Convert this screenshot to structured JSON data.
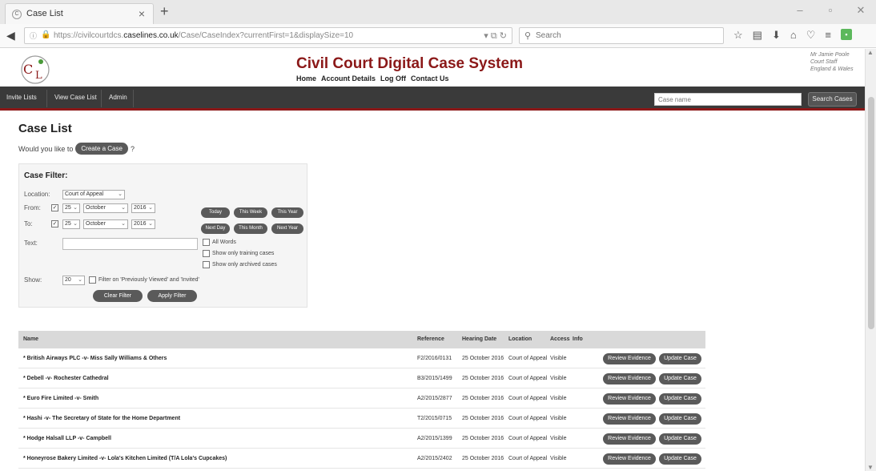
{
  "browser": {
    "tab_title": "Case List",
    "tab_close": "×",
    "new_tab": "+",
    "url_prefix": "https://civilcourtdcs.",
    "url_domain": "caselines.co.uk",
    "url_path": "/Case/CaseIndex?currentFirst=1&displaySize=10",
    "search_placeholder": "Search",
    "window_controls": [
      "–",
      "▫",
      "✕"
    ]
  },
  "header": {
    "logo_text": "C L",
    "title": "Civil Court Digital Case System",
    "links": [
      "Home",
      "Account Details",
      "Log Off",
      "Contact Us"
    ],
    "user_lines": [
      "Mr Jamie Poole",
      "Court Staff",
      "England & Wales"
    ]
  },
  "nav": {
    "items": [
      "Invite Lists",
      "View Case List",
      "Admin"
    ],
    "search_placeholder": "Case name",
    "search_button": "Search Cases"
  },
  "page": {
    "title": "Case List",
    "create_prefix": "Would you like to",
    "create_button": "Create a Case",
    "create_suffix": "?"
  },
  "filter": {
    "title": "Case Filter:",
    "location_label": "Location:",
    "location_value": "Court of Appeal",
    "from_label": "From:",
    "from_day": "25",
    "from_month": "October",
    "from_year": "2016",
    "to_label": "To:",
    "to_day": "25",
    "to_month": "October",
    "to_year": "2016",
    "quick_row1": [
      "Today",
      "This Week",
      "This Year"
    ],
    "quick_row2": [
      "Next Day",
      "This Month",
      "Next Year"
    ],
    "text_label": "Text:",
    "all_words": "All Words",
    "show_training": "Show only training cases",
    "show_archived": "Show only archived cases",
    "show_label": "Show:",
    "show_value": "20",
    "filter_viewed": "Filter on 'Previously Viewed' and 'Invited'",
    "clear_button": "Clear Filter",
    "apply_button": "Apply Filter"
  },
  "table": {
    "headers": [
      "Name",
      "Reference",
      "Hearing Date",
      "Location",
      "Access",
      "Info"
    ],
    "review_label": "Review Evidence",
    "update_label": "Update Case",
    "rows": [
      {
        "name": "* British Airways PLC -v- Miss Sally Williams & Others",
        "reference": "F2/2016/0131",
        "date": "25 October 2016",
        "location": "Court of Appeal",
        "access": "Visible"
      },
      {
        "name": "* Debell -v- Rochester Cathedral",
        "reference": "B3/2015/1499",
        "date": "25 October 2016",
        "location": "Court of Appeal",
        "access": "Visible"
      },
      {
        "name": "* Euro Fire Limited -v- Smith",
        "reference": "A2/2015/2877",
        "date": "25 October 2016",
        "location": "Court of Appeal",
        "access": "Visible"
      },
      {
        "name": "* Hashi -v- The Secretary of State for the Home Department",
        "reference": "T2/2015/0715",
        "date": "25 October 2016",
        "location": "Court of Appeal",
        "access": "Visible"
      },
      {
        "name": "* Hodge Halsall LLP -v- Campbell",
        "reference": "A2/2015/1399",
        "date": "25 October 2016",
        "location": "Court of Appeal",
        "access": "Visible"
      },
      {
        "name": "* Honeyrose Bakery Limited -v- Lola's Kitchen Limited (T/A Lola's Cupcakes)",
        "reference": "A2/2015/2402",
        "date": "25 October 2016",
        "location": "Court of Appeal",
        "access": "Visible"
      }
    ]
  },
  "colors": {
    "brand": "#8b1818",
    "nav_bg": "#3a3a3a",
    "button_bg": "#5a5a5a"
  }
}
